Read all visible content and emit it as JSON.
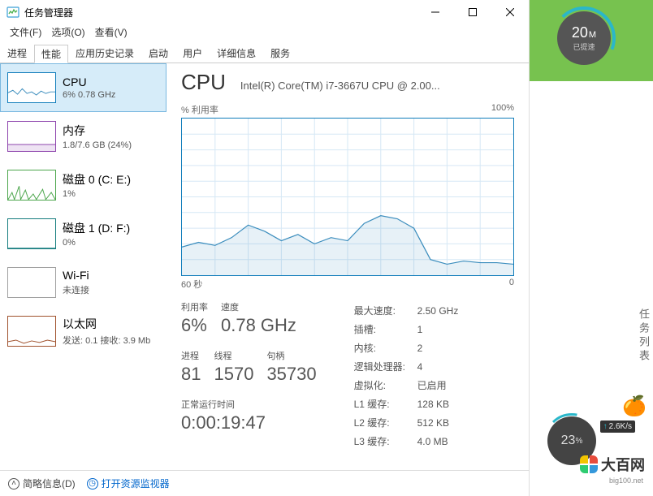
{
  "titlebar": {
    "title": "任务管理器"
  },
  "menu": {
    "file": "文件(F)",
    "options": "选项(O)",
    "view": "查看(V)"
  },
  "tabs": [
    "进程",
    "性能",
    "应用历史记录",
    "启动",
    "用户",
    "详细信息",
    "服务"
  ],
  "activeTab": 1,
  "sidebar": [
    {
      "name": "CPU",
      "stat": "6% 0.78 GHz",
      "thumbClass": "",
      "line": "0,25 6,22 12,27 18,20 24,26 30,24 36,28 42,23 48,26 54,24 60,24"
    },
    {
      "name": "内存",
      "stat": "1.8/7.6 GB (24%)",
      "thumbClass": "purple",
      "line": "0,29 60,29"
    },
    {
      "name": "磁盘 0 (C: E:)",
      "stat": "1%",
      "thumbClass": "green",
      "line": "0,37 5,28 8,37 14,20 16,37 22,25 26,37 32,30 36,37 44,24 48,37 55,28 60,37"
    },
    {
      "name": "磁盘 1 (D: F:)",
      "stat": "0%",
      "thumbClass": "teal",
      "line": "0,37 60,37"
    },
    {
      "name": "Wi-Fi",
      "stat": "未连接",
      "thumbClass": "wifi",
      "line": ""
    },
    {
      "name": "以太网",
      "stat": "发送: 0.1  接收: 3.9 Mb",
      "thumbClass": "orange",
      "line": "0,32 10,30 20,34 30,31 40,33 50,30 60,32"
    }
  ],
  "main": {
    "title": "CPU",
    "subtitle": "Intel(R) Core(TM) i7-3667U CPU @ 2.00...",
    "topLeft": "% 利用率",
    "topRight": "100%",
    "botLeft": "60 秒",
    "botRight": "0",
    "stats1": [
      [
        {
          "label": "利用率",
          "val": "6%"
        },
        {
          "label": "速度",
          "val": "0.78 GHz"
        }
      ],
      [
        {
          "label": "进程",
          "val": "81"
        },
        {
          "label": "线程",
          "val": "1570"
        },
        {
          "label": "句柄",
          "val": "35730"
        }
      ]
    ],
    "uptimeLabel": "正常运行时间",
    "uptime": "0:00:19:47",
    "info": [
      [
        "最大速度:",
        "2.50 GHz"
      ],
      [
        "插槽:",
        "1"
      ],
      [
        "内核:",
        "2"
      ],
      [
        "逻辑处理器:",
        "4"
      ],
      [
        "虚拟化:",
        "已启用"
      ],
      [
        "L1 缓存:",
        "128 KB"
      ],
      [
        "L2 缓存:",
        "512 KB"
      ],
      [
        "L3 缓存:",
        "4.0 MB"
      ]
    ]
  },
  "footer": {
    "less": "简略信息(D)",
    "resmon": "打开资源监视器"
  },
  "chart_data": {
    "type": "line",
    "title": "CPU % 利用率",
    "xlabel": "秒",
    "ylabel": "% 利用率",
    "xlim": [
      0,
      60
    ],
    "ylim": [
      0,
      100
    ],
    "x": [
      0,
      3,
      6,
      9,
      12,
      15,
      18,
      21,
      24,
      27,
      30,
      33,
      36,
      39,
      42,
      45,
      48,
      51,
      54,
      57,
      60
    ],
    "values": [
      18,
      21,
      19,
      24,
      32,
      28,
      22,
      26,
      20,
      24,
      22,
      33,
      38,
      36,
      30,
      10,
      7,
      9,
      8,
      8,
      7
    ]
  },
  "right": {
    "gauge1": {
      "value": "20",
      "unit": "M",
      "label": "已提速"
    },
    "vtext": "任务列表",
    "gauge2": {
      "value": "23",
      "unit": "%"
    },
    "netrate": "2.6K/s",
    "logo": "大百网",
    "url": "big100.net"
  }
}
